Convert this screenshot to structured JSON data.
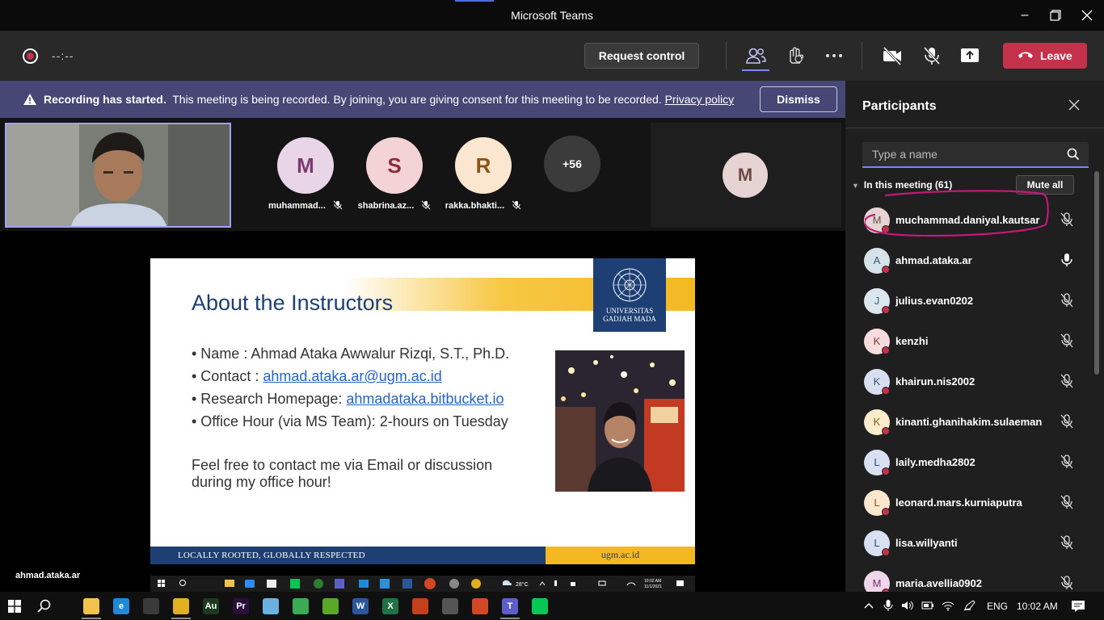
{
  "window": {
    "title": "Microsoft Teams"
  },
  "meeting_bar": {
    "timer": "--:--",
    "request_control_label": "Request control",
    "leave_label": "Leave"
  },
  "banner": {
    "bold": "Recording has started.",
    "text": "This meeting is being recorded. By joining, you are giving consent for this meeting to be recorded.",
    "link": "Privacy policy",
    "dismiss_label": "Dismiss"
  },
  "stage": {
    "tiles": [
      {
        "initial": "M",
        "name": "muhammad...",
        "bg": "#e8d6e8",
        "fg": "#7a3a6e"
      },
      {
        "initial": "S",
        "name": "shabrina.az...",
        "bg": "#f3d3d5",
        "fg": "#8a2e37"
      },
      {
        "initial": "R",
        "name": "rakka.bhakti...",
        "bg": "#fbe7cf",
        "fg": "#8a5416"
      }
    ],
    "more_count": "+56",
    "corner_tile_initial": "M",
    "presenter_name": "ahmad.ataka.ar"
  },
  "slide": {
    "title": "About the Instructors",
    "logo_text_1": "UNIVERSITAS",
    "logo_text_2": "GADJAH MADA",
    "bullet_name": "• Name : Ahmad Ataka Awwalur Rizqi, S.T., Ph.D.",
    "bullet_contact_prefix": "• Contact : ",
    "bullet_contact_link": "ahmad.ataka.ar@ugm.ac.id",
    "bullet_homepage_prefix": "• Research Homepage: ",
    "bullet_homepage_link": "ahmadataka.bitbucket.io",
    "bullet_office": "• Office Hour (via MS Team): 2-hours on Tuesday",
    "closing": "Feel free to contact me via Email or discussion during my office hour!",
    "footer_left": "LOCALLY ROOTED, GLOBALLY RESPECTED",
    "footer_right": "ugm.ac.id"
  },
  "inner_taskbar": {
    "temp": "28°C",
    "time": "10:02 AM",
    "date": "11/1/2021"
  },
  "participants": {
    "title": "Participants",
    "search_placeholder": "Type a name",
    "section_label": "In this meeting (61)",
    "mute_all_label": "Mute all",
    "list": [
      {
        "initial": "M",
        "name": "muchammad.daniyal.kautsar",
        "bg": "#e6d4d2",
        "fg": "#6b4a46",
        "mic": "muted"
      },
      {
        "initial": "A",
        "name": "ahmad.ataka.ar",
        "bg": "#d5e2ea",
        "fg": "#375a70",
        "mic": "on"
      },
      {
        "initial": "J",
        "name": "julius.evan0202",
        "bg": "#dbe6ef",
        "fg": "#3e5d76",
        "mic": "muted"
      },
      {
        "initial": "K",
        "name": "kenzhi",
        "bg": "#f6dcdc",
        "fg": "#8a3232",
        "mic": "muted"
      },
      {
        "initial": "K",
        "name": "khairun.nis2002",
        "bg": "#d8e0ef",
        "fg": "#3b4f78",
        "mic": "muted"
      },
      {
        "initial": "K",
        "name": "kinanti.ghanihakim.sulaeman",
        "bg": "#fbeccb",
        "fg": "#8a6416",
        "mic": "muted"
      },
      {
        "initial": "L",
        "name": "laily.medha2802",
        "bg": "#d8e0f2",
        "fg": "#34487a",
        "mic": "muted"
      },
      {
        "initial": "L",
        "name": "leonard.mars.kurniaputra",
        "bg": "#fbe7cf",
        "fg": "#8a5416",
        "mic": "muted"
      },
      {
        "initial": "L",
        "name": "lisa.willyanti",
        "bg": "#d8e0f2",
        "fg": "#34487a",
        "mic": "muted"
      },
      {
        "initial": "M",
        "name": "maria.avellia0902",
        "bg": "#f0d6ea",
        "fg": "#7a2e6a",
        "mic": "muted"
      }
    ]
  },
  "taskbar": {
    "apps": [
      {
        "name": "file-explorer",
        "letter": "",
        "color": "#f2c14e"
      },
      {
        "name": "edge",
        "letter": "e",
        "color": "#1f8ad8"
      },
      {
        "name": "store",
        "letter": "",
        "color": "#3a3a3a"
      },
      {
        "name": "chrome",
        "letter": "",
        "color": "#e0b020"
      },
      {
        "name": "audition",
        "letter": "Au",
        "color": "#1e3a1e"
      },
      {
        "name": "premiere",
        "letter": "Pr",
        "color": "#2a0f3a"
      },
      {
        "name": "notepad",
        "letter": "",
        "color": "#6ab0e0"
      },
      {
        "name": "media-player",
        "letter": "",
        "color": "#3aaa55"
      },
      {
        "name": "utorrent",
        "letter": "",
        "color": "#5aa82a"
      },
      {
        "name": "word",
        "letter": "W",
        "color": "#2b579a"
      },
      {
        "name": "excel",
        "letter": "X",
        "color": "#217346"
      },
      {
        "name": "matlab",
        "letter": "",
        "color": "#c4401a"
      },
      {
        "name": "audio-app",
        "letter": "",
        "color": "#555"
      },
      {
        "name": "powerpoint",
        "letter": "",
        "color": "#d24726"
      },
      {
        "name": "teams",
        "letter": "T",
        "color": "#5b5fc7"
      },
      {
        "name": "line",
        "letter": "",
        "color": "#06c755"
      }
    ],
    "language": "ENG",
    "time": "10:02 AM"
  },
  "colors": {
    "leave": "#c4314b",
    "banner": "#464775",
    "accent": "#7f85f5",
    "ugm_blue": "#1d3f74",
    "ugm_gold": "#f4b922"
  }
}
